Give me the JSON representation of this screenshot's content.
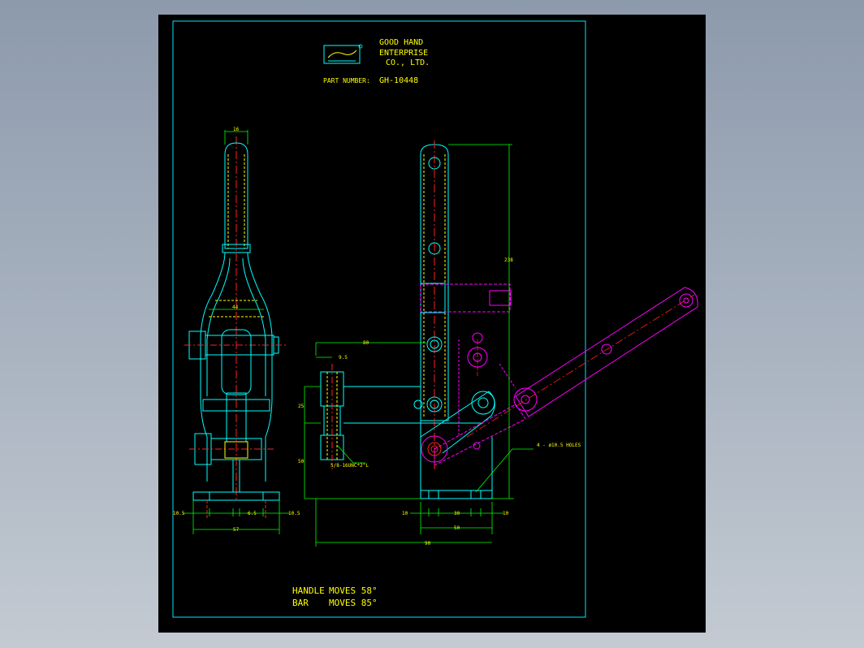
{
  "title_block": {
    "company_line1": "GOOD HAND",
    "company_line2": "ENTERPRISE",
    "company_line3": "CO., LTD.",
    "part_number_label": "PART NUMBER:",
    "part_number": "GH-10448",
    "logo_text": "GOOD HAND"
  },
  "notes": {
    "handle_label": "HANDLE",
    "handle_moves": "MOVES 58°",
    "bar_label": "BAR",
    "bar_moves": "MOVES 85°"
  },
  "dimensions": {
    "top_width": "16",
    "mid_width": "44",
    "left_offset": "10.5",
    "center_offset": "6.5",
    "right_offset": "10.5",
    "base_width": "57",
    "height_238": "238",
    "horiz_80": "80",
    "bolt_9_5": "9.5",
    "v_25": "25",
    "v_50": "50",
    "bolt_note": "5/8-16UNC*2\"L",
    "holes_note": "4 - ø10.5 HOLES",
    "base_10_left": "10",
    "base_30": "30",
    "base_10_right": "10",
    "base_50": "50",
    "overall_90": "90"
  },
  "colors": {
    "frame": "#00e5ff",
    "outline": "#00ffff",
    "dimension": "#00ff00",
    "centerline": "#ff2020",
    "hidden": "#ffff00",
    "handle_alt": "#ff00ff",
    "text": "#ffff00"
  }
}
